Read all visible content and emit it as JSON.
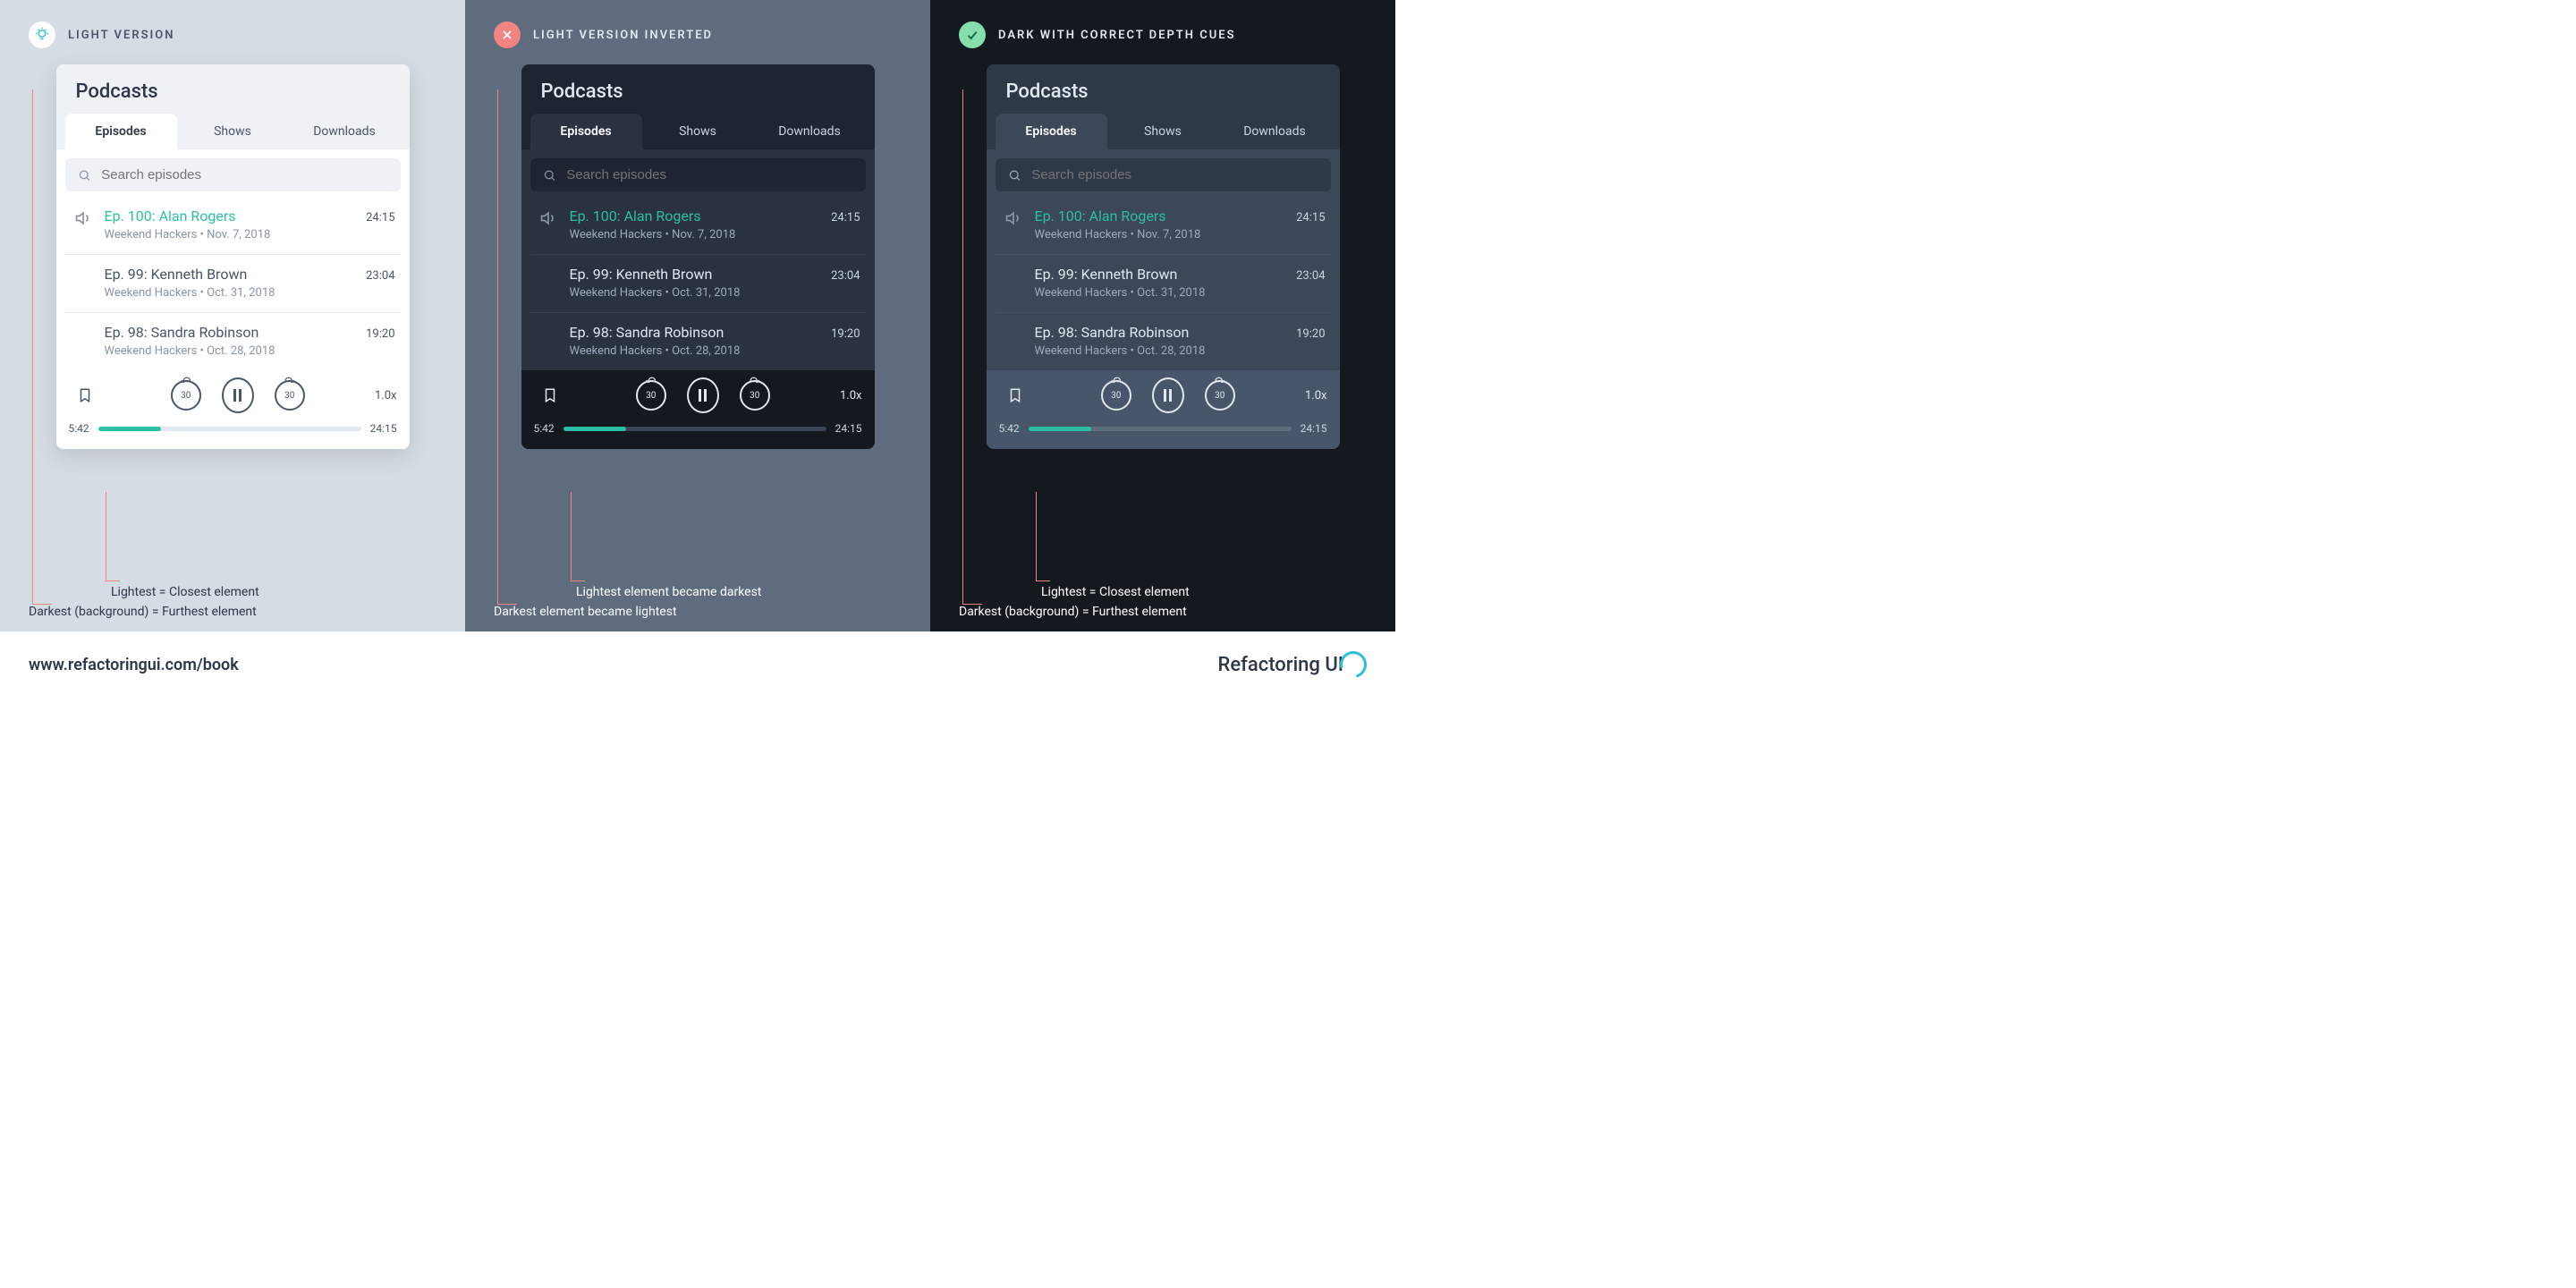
{
  "panels": [
    {
      "title": "LIGHT VERSION",
      "anno1": "Lightest = Closest element",
      "anno2": "Darkest (background) = Furthest element"
    },
    {
      "title": "LIGHT VERSION INVERTED",
      "anno1": "Lightest element became darkest",
      "anno2": "Darkest element became lightest"
    },
    {
      "title": "DARK WITH CORRECT DEPTH CUES",
      "anno1": "Lightest = Closest element",
      "anno2": "Darkest (background) = Furthest element"
    }
  ],
  "card": {
    "title": "Podcasts",
    "tabs": [
      "Episodes",
      "Shows",
      "Downloads"
    ],
    "search_placeholder": "Search episodes",
    "episodes": [
      {
        "title": "Ep. 100: Alan Rogers",
        "sub": "Weekend Hackers • Nov. 7, 2018",
        "dur": "24:15",
        "playing": true
      },
      {
        "title": "Ep. 99: Kenneth Brown",
        "sub": "Weekend Hackers • Oct. 31, 2018",
        "dur": "23:04",
        "playing": false
      },
      {
        "title": "Ep. 98: Sandra Robinson",
        "sub": "Weekend Hackers • Oct. 28, 2018",
        "dur": "19:20",
        "playing": false
      }
    ],
    "player": {
      "skip": "30",
      "speed": "1.0x",
      "elapsed": "5:42",
      "total": "24:15"
    }
  },
  "footer": {
    "url": "www.refactoringui.com/book",
    "brand": "Refactoring UI"
  }
}
